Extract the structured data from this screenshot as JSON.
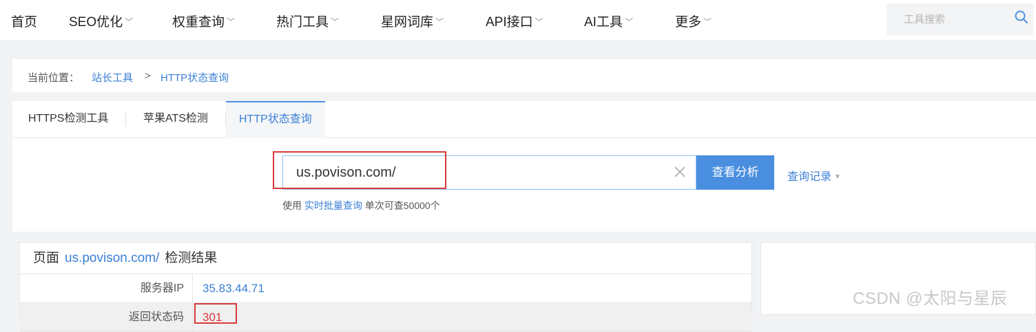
{
  "nav": {
    "items": [
      {
        "label": "首页",
        "dropdown": false
      },
      {
        "label": "SEO优化",
        "dropdown": true
      },
      {
        "label": "权重查询",
        "dropdown": true
      },
      {
        "label": "热门工具",
        "dropdown": true
      },
      {
        "label": "星网词库",
        "dropdown": true
      },
      {
        "label": "API接口",
        "dropdown": true
      },
      {
        "label": "AI工具",
        "dropdown": true
      },
      {
        "label": "更多",
        "dropdown": true
      }
    ],
    "chevron": "﹀",
    "search_placeholder": "工具搜索",
    "search_icon": "search-icon"
  },
  "breadcrumb": {
    "prefix": "当前位置：",
    "items": [
      "站长工具",
      "HTTP状态查询"
    ],
    "separator": ">"
  },
  "tabs": [
    {
      "label": "HTTPS检测工具",
      "active": false
    },
    {
      "label": "苹果ATS检测",
      "active": false
    },
    {
      "label": "HTTP状态查询",
      "active": true
    }
  ],
  "query": {
    "input_value": "us.povison.com/",
    "button_label": "查看分析",
    "history_label": "查询记录",
    "history_caret": "▼",
    "hint_prefix": "使用",
    "hint_link": "实时批量查询",
    "hint_suffix": "单次可查50000个"
  },
  "result": {
    "head_prefix": "页面",
    "domain": "us.povison.com/",
    "head_suffix": "检测结果",
    "rows": [
      {
        "label": "服务器IP",
        "value": "35.83.44.71"
      },
      {
        "label": "返回状态码",
        "value": "301"
      }
    ]
  },
  "watermark": "CSDN @太阳与星辰",
  "colors": {
    "accent": "#4a8fdf",
    "link": "#3a7fd5",
    "highlight": "#d9383a"
  }
}
